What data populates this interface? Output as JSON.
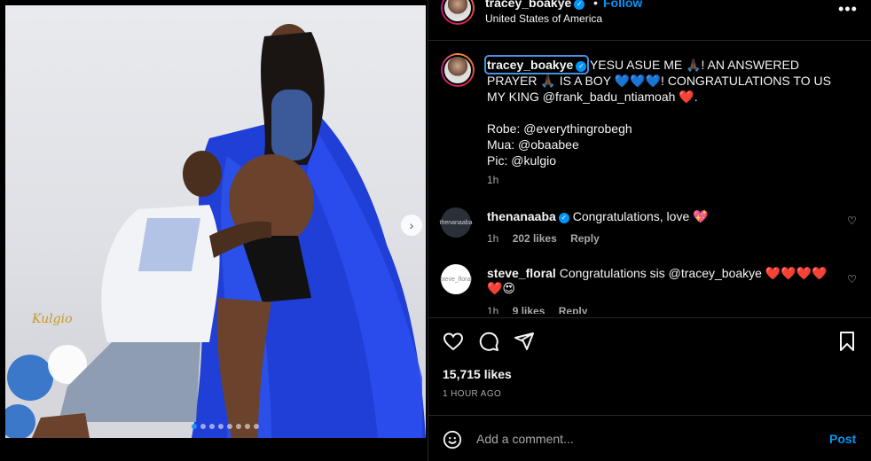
{
  "post": {
    "image_dots": 8,
    "active_dot": 0,
    "watermark": "Kulgio"
  },
  "header": {
    "username": "tracey_boakye",
    "follow_label": "Follow",
    "separator": "•",
    "location": "United States of America",
    "more": "•••"
  },
  "caption": {
    "username": "tracey_boakye",
    "text": " YESU ASUE ME 🙏🏿! AN ANSWERED PRAYER 🙏🏿 IS A BOY 💙💙💙! CONGRATULATIONS TO US MY KING @frank_badu_ntiamoah ❤️.",
    "credit_robe": "Robe: @everythingrobegh",
    "credit_mua": "Mua: @obaabee",
    "credit_pic": "Pic: @kulgio",
    "time": "1h"
  },
  "comments": [
    {
      "username": "thenanaaba",
      "verified": true,
      "text": " Congratulations, love 💖",
      "time": "1h",
      "likes": "202 likes",
      "reply": "Reply"
    },
    {
      "username": "steve_floral",
      "verified": false,
      "text": " Congratulations sis @tracey_boakye ❤️❤️❤️❤️❤️😍",
      "time": "1h",
      "likes": "9 likes",
      "reply": "Reply"
    }
  ],
  "engagement": {
    "likes": "15,715 likes",
    "posted": "1 HOUR AGO"
  },
  "composer": {
    "placeholder": "Add a comment...",
    "post_label": "Post"
  },
  "colors": {
    "accent": "#0095f6",
    "background": "#000000",
    "text": "#f5f5f5",
    "muted": "#a8a8a8"
  }
}
